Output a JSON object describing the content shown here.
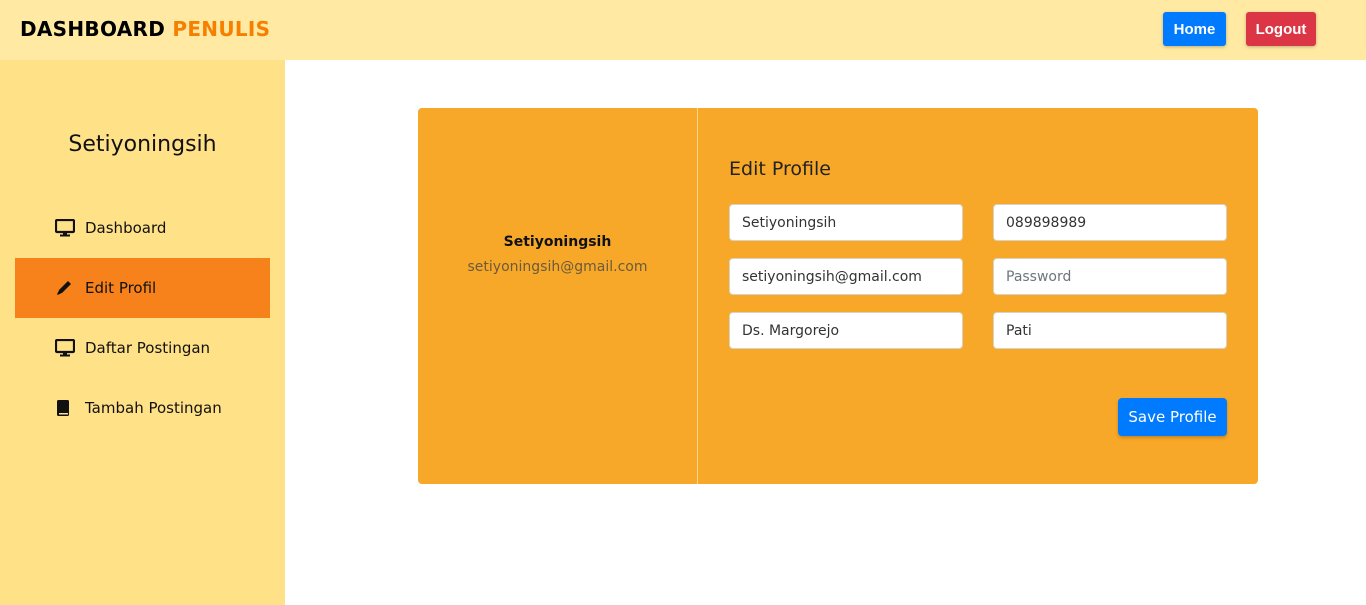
{
  "header": {
    "brand_main": "DASHBOARD",
    "brand_accent": "PENULIS",
    "home_label": "Home",
    "logout_label": "Logout"
  },
  "sidebar": {
    "user_name": "Setiyoningsih",
    "items": [
      {
        "label": "Dashboard",
        "icon": "monitor-icon",
        "active": false
      },
      {
        "label": "Edit Profil",
        "icon": "pencil-icon",
        "active": true
      },
      {
        "label": "Daftar Postingan",
        "icon": "monitor-icon",
        "active": false
      },
      {
        "label": "Tambah Postingan",
        "icon": "book-icon",
        "active": false
      }
    ]
  },
  "profile_card": {
    "name": "Setiyoningsih",
    "email": "setiyoningsih@gmail.com",
    "form_title": "Edit Profile",
    "fields": {
      "name": {
        "value": "Setiyoningsih",
        "placeholder": ""
      },
      "phone": {
        "value": "089898989",
        "placeholder": ""
      },
      "email": {
        "value": "setiyoningsih@gmail.com",
        "placeholder": ""
      },
      "password": {
        "value": "",
        "placeholder": "Password"
      },
      "address": {
        "value": "Ds. Margorejo",
        "placeholder": ""
      },
      "city": {
        "value": "Pati",
        "placeholder": ""
      }
    },
    "save_label": "Save Profile"
  },
  "colors": {
    "topbar": "#ffe9a3",
    "sidebar": "#ffe187",
    "active_item": "#f7821b",
    "card": "#f8a828",
    "brand_accent": "#f77f00",
    "primary": "#007bff",
    "danger": "#dc3545"
  }
}
